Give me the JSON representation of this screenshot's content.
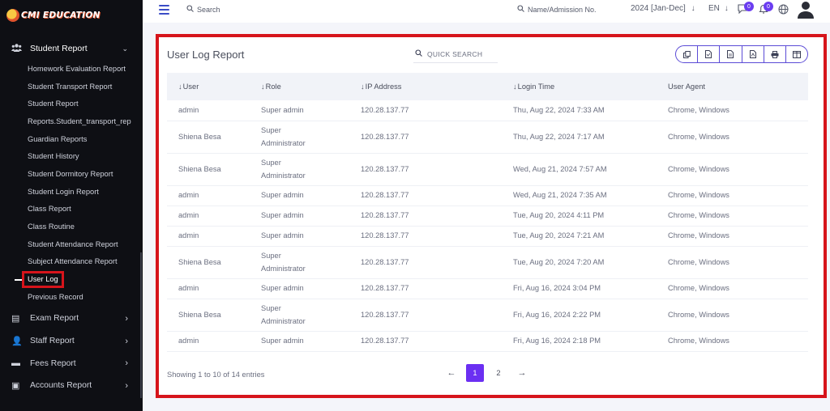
{
  "brand": {
    "name": "CMI EDUCATION"
  },
  "sidebar": {
    "section": {
      "label": "Student Report",
      "icon": "users-icon"
    },
    "items": [
      {
        "label": "Homework Evaluation Report"
      },
      {
        "label": "Student Transport Report"
      },
      {
        "label": "Student Report"
      },
      {
        "label": "Reports.Student_transport_rep"
      },
      {
        "label": "Guardian Reports"
      },
      {
        "label": "Student History"
      },
      {
        "label": "Student Dormitory Report"
      },
      {
        "label": "Student Login Report"
      },
      {
        "label": "Class Report"
      },
      {
        "label": "Class Routine"
      },
      {
        "label": "Student Attendance Report"
      },
      {
        "label": "Subject Attendance Report"
      },
      {
        "label": "User Log"
      },
      {
        "label": "Previous Record"
      }
    ],
    "active_item": "User Log",
    "bottom": [
      {
        "label": "Exam Report",
        "icon": "book-icon"
      },
      {
        "label": "Staff Report",
        "icon": "staff-icon"
      },
      {
        "label": "Fees Report",
        "icon": "money-icon"
      },
      {
        "label": "Accounts Report",
        "icon": "wallet-icon"
      }
    ]
  },
  "topbar": {
    "search_label": "Search",
    "name_search_label": "Name/Admission No.",
    "year": "2024 [Jan-Dec]",
    "language": "EN",
    "messages_count": "0",
    "notifications_count": "0"
  },
  "report": {
    "title": "User Log Report",
    "quick_search": "QUICK SEARCH",
    "columns": [
      "User",
      "Role",
      "IP Address",
      "Login Time",
      "User Agent"
    ],
    "rows": [
      {
        "user": "admin",
        "role": "Super admin",
        "ip": "120.28.137.77",
        "time": "Thu, Aug 22, 2024 7:33 AM",
        "agent": "Chrome, Windows"
      },
      {
        "user": "Shiena Besa",
        "role": "Super Administrator",
        "ip": "120.28.137.77",
        "time": "Thu, Aug 22, 2024 7:17 AM",
        "agent": "Chrome, Windows"
      },
      {
        "user": "Shiena Besa",
        "role": "Super Administrator",
        "ip": "120.28.137.77",
        "time": "Wed, Aug 21, 2024 7:57 AM",
        "agent": "Chrome, Windows"
      },
      {
        "user": "admin",
        "role": "Super admin",
        "ip": "120.28.137.77",
        "time": "Wed, Aug 21, 2024 7:35 AM",
        "agent": "Chrome, Windows"
      },
      {
        "user": "admin",
        "role": "Super admin",
        "ip": "120.28.137.77",
        "time": "Tue, Aug 20, 2024 4:11 PM",
        "agent": "Chrome, Windows"
      },
      {
        "user": "admin",
        "role": "Super admin",
        "ip": "120.28.137.77",
        "time": "Tue, Aug 20, 2024 7:21 AM",
        "agent": "Chrome, Windows"
      },
      {
        "user": "Shiena Besa",
        "role": "Super Administrator",
        "ip": "120.28.137.77",
        "time": "Tue, Aug 20, 2024 7:20 AM",
        "agent": "Chrome, Windows"
      },
      {
        "user": "admin",
        "role": "Super admin",
        "ip": "120.28.137.77",
        "time": "Fri, Aug 16, 2024 3:04 PM",
        "agent": "Chrome, Windows"
      },
      {
        "user": "Shiena Besa",
        "role": "Super Administrator",
        "ip": "120.28.137.77",
        "time": "Fri, Aug 16, 2024 2:22 PM",
        "agent": "Chrome, Windows"
      },
      {
        "user": "admin",
        "role": "Super admin",
        "ip": "120.28.137.77",
        "time": "Fri, Aug 16, 2024 2:18 PM",
        "agent": "Chrome, Windows"
      }
    ],
    "entries_info": "Showing 1 to 10 of 14 entries",
    "pages": [
      "1",
      "2"
    ],
    "current_page": "1"
  },
  "colors": {
    "accent": "#6b2ff2",
    "highlight": "#d6141b",
    "sidebar_bg": "#0e0f14"
  }
}
